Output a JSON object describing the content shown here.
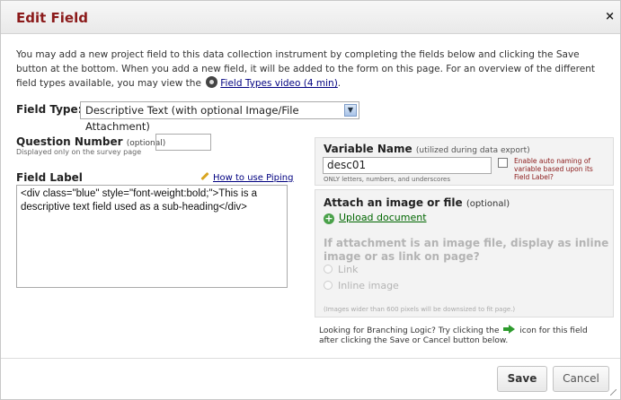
{
  "dialog": {
    "title": "Edit Field",
    "close_label": "×"
  },
  "intro": {
    "text": "You may add a new project field to this data collection instrument by completing the fields below and clicking the Save button at the bottom. When you add a new field, it will be added to the form on this page. For an overview of the different field types available, you may view the",
    "video_link": "Field Types video (4 min)",
    "suffix": "."
  },
  "field_type": {
    "label": "Field Type:",
    "selected": "Descriptive Text (with optional Image/File Attachment)",
    "arrow": "▼"
  },
  "question_number": {
    "label": "Question Number",
    "optional": "(optional)",
    "sublabel": "Displayed only on the survey page",
    "value": ""
  },
  "field_label": {
    "label": "Field Label",
    "piping_link": "How to use Piping",
    "value": "<div class=\"blue\" style=\"font-weight:bold;\">This is a descriptive text field used as a sub-heading</div>"
  },
  "variable_name": {
    "label": "Variable Name",
    "optional": "(utilized during data export)",
    "value": "desc01",
    "help": "ONLY letters, numbers, and underscores",
    "auto_naming": "Enable auto naming of variable based upon its Field Label?"
  },
  "attachment": {
    "label": "Attach an image or file",
    "optional": "(optional)",
    "upload_link": "Upload document",
    "inline_question": "If attachment is an image file, display as inline image or as link on page?",
    "option_link": "Link",
    "option_inline": "Inline image",
    "note": "(Images wider than 600 pixels will be downsized to fit page.)"
  },
  "branching": {
    "before": "Looking for Branching Logic? Try clicking the",
    "after": "icon for this field after clicking the Save or Cancel button below."
  },
  "footer": {
    "save": "Save",
    "cancel": "Cancel"
  }
}
